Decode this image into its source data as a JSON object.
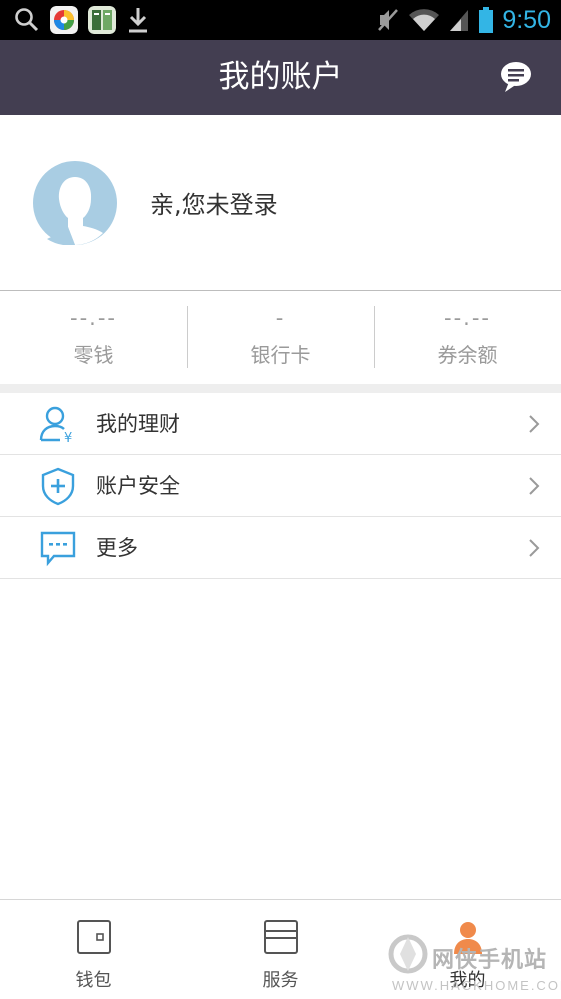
{
  "status_bar": {
    "time": "9:50",
    "left_icons": [
      "search-icon",
      "app-game-icon",
      "app-book-icon",
      "download-icon"
    ],
    "right_icons": [
      "mute-icon",
      "wifi-icon",
      "signal-icon",
      "battery-icon"
    ],
    "accent": "#33b5e5"
  },
  "header": {
    "title": "我的账户",
    "background": "#433e51",
    "right_icon": "chat-icon"
  },
  "profile": {
    "login_prompt": "亲,您未登录",
    "avatar_icon": "default-avatar-icon"
  },
  "balances": [
    {
      "value": "--.--",
      "label": "零钱"
    },
    {
      "value": "-",
      "label": "银行卡"
    },
    {
      "value": "--.--",
      "label": "券余额"
    }
  ],
  "menu": {
    "items": [
      {
        "label": "我的理财",
        "icon": "user-finance-icon"
      },
      {
        "label": "账户安全",
        "icon": "shield-plus-icon"
      },
      {
        "label": "更多",
        "icon": "message-more-icon"
      }
    ],
    "icon_color": "#3aa0dd"
  },
  "tabbar": {
    "tabs": [
      {
        "label": "钱包",
        "icon": "wallet-icon"
      },
      {
        "label": "服务",
        "icon": "service-icon"
      },
      {
        "label": "我的",
        "icon": "me-icon",
        "active": true
      }
    ],
    "active_color": "#f08a4b"
  },
  "watermark": {
    "text": "网侠手机站",
    "url": "WWW.HACKHOME.COM"
  }
}
